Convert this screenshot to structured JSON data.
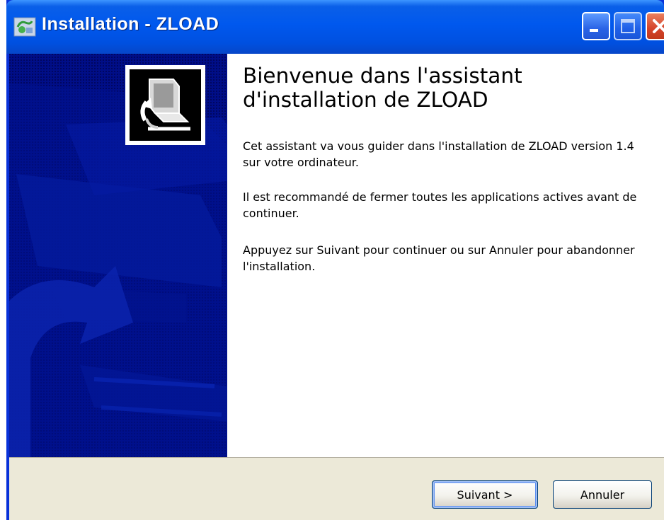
{
  "window": {
    "title": "Installation - ZLOAD",
    "controls": {
      "minimize": "minimize-icon",
      "maximize": "maximize-icon",
      "close": "close-icon"
    }
  },
  "wizard": {
    "heading_line1": "Bienvenue dans l'assistant",
    "heading_line2": "d'installation de ZLOAD",
    "paragraph1": "Cet assistant va vous guider dans l'installation de ZLOAD version 1.4 sur votre ordinateur.",
    "paragraph2": "Il est recommandé de fermer toutes les applications actives avant de continuer.",
    "paragraph3": "Appuyez sur Suivant pour continuer ou sur Annuler pour abandonner l'installation."
  },
  "buttons": {
    "next_label": "Suivant >",
    "cancel_label": "Annuler"
  },
  "colors": {
    "titlebar": "#0058ee",
    "side_panel": "#000c80",
    "footer": "#ece9d8"
  }
}
